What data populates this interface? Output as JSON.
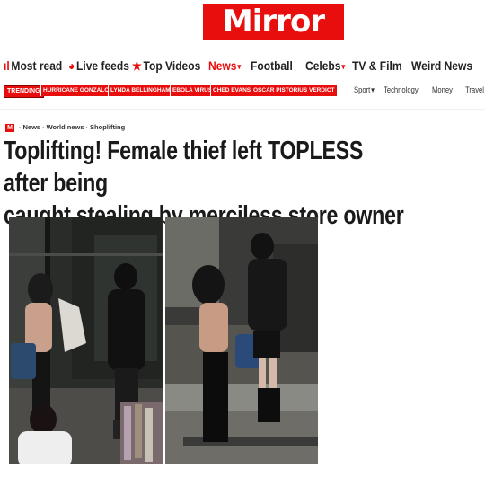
{
  "brand": {
    "logo": "Mirror",
    "color": "#e90e0e"
  },
  "nav": {
    "items": [
      {
        "label": "Most read",
        "icon": "bar-chart-icon",
        "glyph": "ıl"
      },
      {
        "label": "Live feeds",
        "icon": "live-dot-icon",
        "glyph": "◕"
      },
      {
        "label": "Top Videos",
        "icon": "star-icon",
        "glyph": "★"
      },
      {
        "label": "News",
        "active": true,
        "dropdown": true
      },
      {
        "label": "Football"
      },
      {
        "label": "Celebs",
        "dropdown": true
      },
      {
        "label": "TV & Film"
      },
      {
        "label": "Weird News"
      }
    ]
  },
  "subnav": {
    "trending_label": "TRENDING",
    "trending": [
      "HURRICANE GONZALO",
      "LYNDA BELLINGHAM",
      "EBOLA VIRUS",
      "CHED EVANS",
      "OSCAR PISTORIUS VERDICT"
    ],
    "links": [
      "Sport",
      "Technology",
      "Money",
      "Travel"
    ]
  },
  "breadcrumb": {
    "logo": "M",
    "items": [
      "News",
      "World news",
      "Shoplifting"
    ]
  },
  "article": {
    "headline_line1": "Toplifting! Female thief left TOPLESS after being",
    "headline_line2": "caught stealing by merciless store owner",
    "photos": [
      "photo-left",
      "photo-right"
    ]
  }
}
